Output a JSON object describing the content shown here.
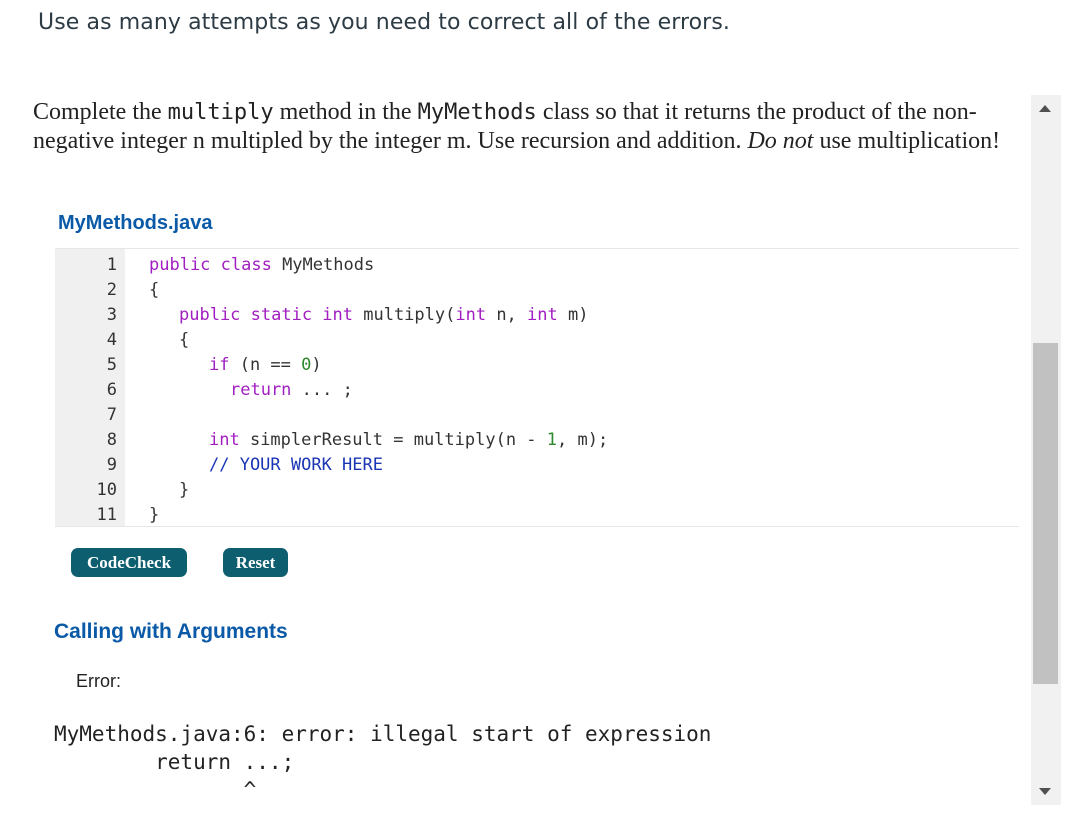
{
  "instruction": "Use as many attempts as you need to correct all of the errors.",
  "problem": {
    "p1": "Complete the ",
    "code1": "multiply",
    "p2": " method in the ",
    "code2": "MyMethods",
    "p3": " class so that it returns the product of the non-negative integer n multipled by the integer m. Use recursion and addition. ",
    "em": "Do not",
    "p4": " use multiplication!"
  },
  "editor": {
    "filename": "MyMethods.java",
    "line_numbers": [
      "1",
      "2",
      "3",
      "4",
      "5",
      "6",
      "7",
      "8",
      "9",
      "10",
      "11"
    ],
    "code": {
      "l1_kw": "public class",
      "l1_rest": " MyMethods",
      "l2": "{",
      "l3_kw": "public static int",
      "l3_a": " multiply(",
      "l3_kw2": "int",
      "l3_b": " n, ",
      "l3_kw3": "int",
      "l3_c": " m)",
      "l4": "{",
      "l5_kw": "if",
      "l5_a": " (n == ",
      "l5_num": "0",
      "l5_b": ")",
      "l6_kw": "return",
      "l6_rest": " ... ;",
      "l8_kw": "int",
      "l8_a": " simplerResult = multiply(n - ",
      "l8_num": "1",
      "l8_b": ", m);",
      "l9_comment": "// YOUR WORK HERE",
      "l10": "}",
      "l11": "}"
    }
  },
  "buttons": {
    "codecheck": "CodeCheck",
    "reset": "Reset"
  },
  "results": {
    "title": "Calling with Arguments",
    "error_label": "Error:",
    "error_line1": "MyMethods.java:6: error: illegal start of expression",
    "error_line2": "        return ...;",
    "error_line3": "               ^"
  },
  "scrollbar": {
    "thumb_start": 0.35,
    "thumb_end": 0.83
  }
}
